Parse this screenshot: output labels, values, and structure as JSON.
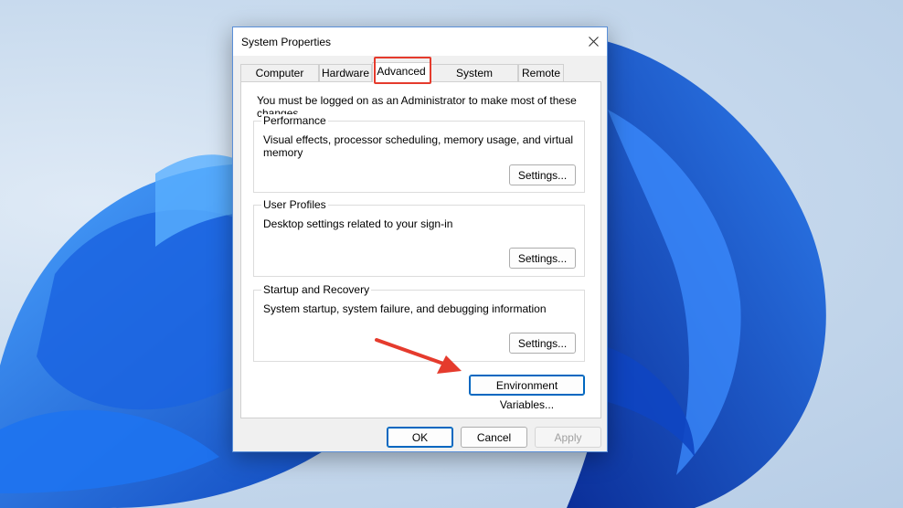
{
  "window": {
    "title": "System Properties"
  },
  "tabs": [
    {
      "label": "Computer Name"
    },
    {
      "label": "Hardware"
    },
    {
      "label": "Advanced"
    },
    {
      "label": "System Protection"
    },
    {
      "label": "Remote"
    }
  ],
  "active_tab": "Advanced",
  "panel": {
    "admin_note": "You must be logged on as an Administrator to make most of these changes.",
    "performance": {
      "label": "Performance",
      "description": "Visual effects, processor scheduling, memory usage, and virtual memory",
      "button": "Settings..."
    },
    "user_profiles": {
      "label": "User Profiles",
      "description": "Desktop settings related to your sign-in",
      "button": "Settings..."
    },
    "startup_recovery": {
      "label": "Startup and Recovery",
      "description": "System startup, system failure, and debugging information",
      "button": "Settings..."
    },
    "env_button": "Environment Variables..."
  },
  "footer": {
    "ok": "OK",
    "cancel": "Cancel",
    "apply": "Apply"
  },
  "colors": {
    "accent": "#0067c0",
    "annotation_red": "#e53b2d",
    "wallpaper_blue": "#1a5fd6"
  }
}
